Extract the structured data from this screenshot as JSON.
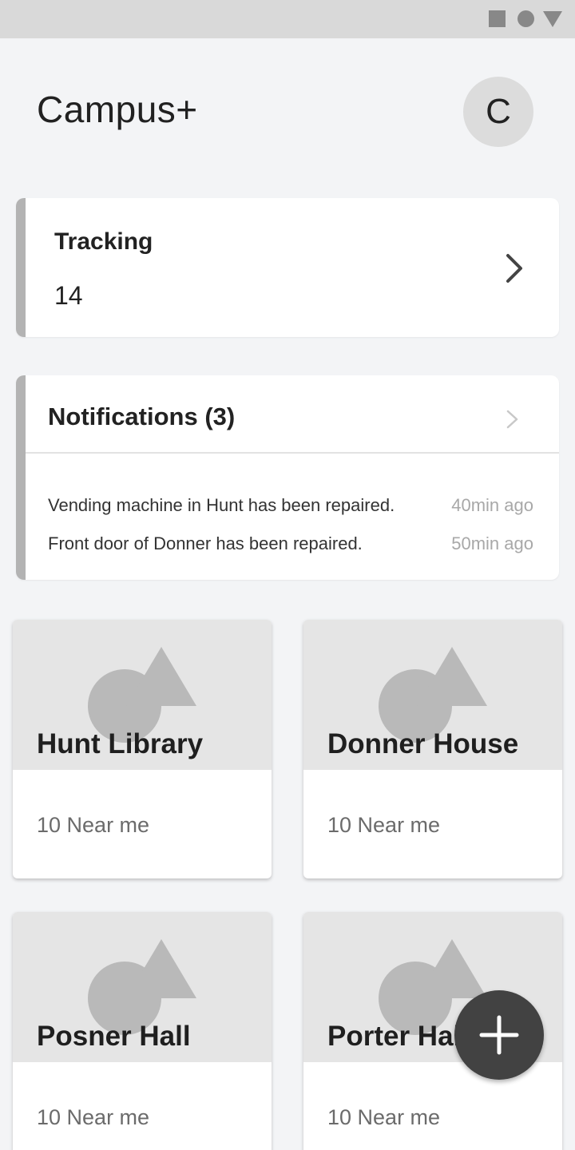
{
  "status_bar": {
    "icons": [
      "square-icon",
      "circle-icon",
      "triangle-icon"
    ]
  },
  "header": {
    "title": "Campus+",
    "avatar_initial": "C"
  },
  "tracking": {
    "label": "Tracking",
    "value": "14"
  },
  "notifications": {
    "title": "Notifications (3)",
    "items": [
      {
        "message": "Vending machine in Hunt has been repaired.",
        "time": "40min ago"
      },
      {
        "message": "Front door of Donner has been repaired.",
        "time": "50min ago"
      }
    ]
  },
  "places": [
    {
      "name": "Hunt Library",
      "subtitle": "10 Near me"
    },
    {
      "name": "Donner House",
      "subtitle": "10 Near me"
    },
    {
      "name": "Posner Hall",
      "subtitle": "10 Near me"
    },
    {
      "name": "Porter Hall",
      "subtitle": "10 Near me"
    }
  ],
  "fab": {
    "icon": "plus-icon"
  },
  "colors": {
    "background": "#f3f4f6",
    "accent_bar": "#b3b3b3",
    "fab": "#424242",
    "secondary_text": "#a8a8a8"
  }
}
